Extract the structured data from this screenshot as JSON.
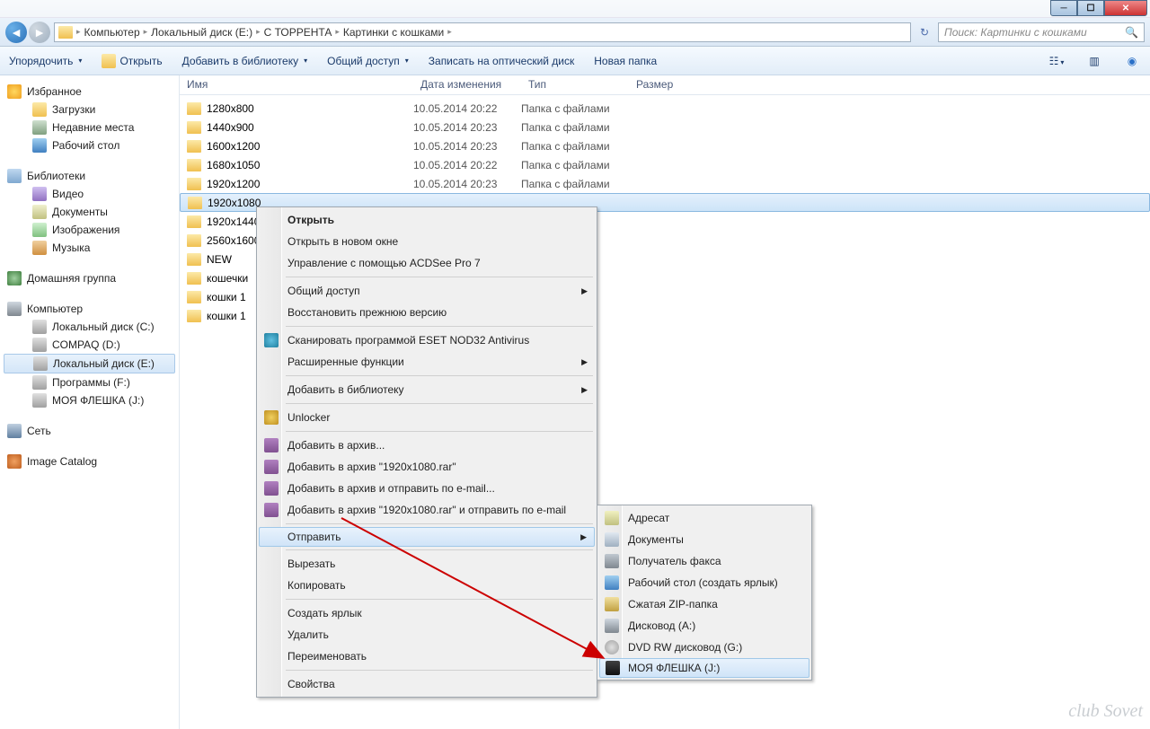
{
  "breadcrumb": [
    "Компьютер",
    "Локальный диск (E:)",
    "С ТОРРЕНТА",
    "Картинки с кошками"
  ],
  "search_placeholder": "Поиск: Картинки с кошками",
  "toolbar": {
    "organize": "Упорядочить",
    "open": "Открыть",
    "add_library": "Добавить в библиотеку",
    "share": "Общий доступ",
    "burn": "Записать на оптический диск",
    "new_folder": "Новая папка"
  },
  "columns": {
    "name": "Имя",
    "date": "Дата изменения",
    "type": "Тип",
    "size": "Размер"
  },
  "sidebar": {
    "favorites": {
      "title": "Избранное",
      "items": [
        "Загрузки",
        "Недавние места",
        "Рабочий стол"
      ]
    },
    "libraries": {
      "title": "Библиотеки",
      "items": [
        "Видео",
        "Документы",
        "Изображения",
        "Музыка"
      ]
    },
    "homegroup": "Домашняя группа",
    "computer": {
      "title": "Компьютер",
      "items": [
        "Локальный диск (C:)",
        "COMPAQ (D:)",
        "Локальный диск (E:)",
        "Программы  (F:)",
        "МОЯ ФЛЕШКА (J:)"
      ]
    },
    "network": "Сеть",
    "catalog": "Image Catalog"
  },
  "files": [
    {
      "name": "1280x800",
      "date": "10.05.2014 20:22",
      "type": "Папка с файлами"
    },
    {
      "name": "1440x900",
      "date": "10.05.2014 20:23",
      "type": "Папка с файлами"
    },
    {
      "name": "1600x1200",
      "date": "10.05.2014 20:23",
      "type": "Папка с файлами"
    },
    {
      "name": "1680x1050",
      "date": "10.05.2014 20:22",
      "type": "Папка с файлами"
    },
    {
      "name": "1920x1200",
      "date": "10.05.2014 20:23",
      "type": "Папка с файлами"
    },
    {
      "name": "1920x1080",
      "date": "",
      "type": "",
      "selected": true
    },
    {
      "name": "1920x1440",
      "date": "",
      "type": ""
    },
    {
      "name": "2560x1600",
      "date": "",
      "type": ""
    },
    {
      "name": "NEW",
      "date": "",
      "type": ""
    },
    {
      "name": "кошечки",
      "date": "",
      "type": ""
    },
    {
      "name": "кошки 1",
      "date": "",
      "type": ""
    },
    {
      "name": "кошки 1",
      "date": "",
      "type": ""
    }
  ],
  "file_tail": "ами",
  "context_menu": [
    {
      "label": "Открыть",
      "bold": true
    },
    {
      "label": "Открыть в новом окне"
    },
    {
      "label": "Управление с помощью ACDSee Pro 7"
    },
    {
      "sep": true
    },
    {
      "label": "Общий доступ",
      "arrow": true
    },
    {
      "label": "Восстановить прежнюю версию"
    },
    {
      "sep": true
    },
    {
      "label": "Сканировать программой ESET NOD32 Antivirus",
      "icon": "ci-nod"
    },
    {
      "label": "Расширенные функции",
      "arrow": true
    },
    {
      "sep": true
    },
    {
      "label": "Добавить в библиотеку",
      "arrow": true
    },
    {
      "sep": true
    },
    {
      "label": "Unlocker",
      "icon": "ci-unl"
    },
    {
      "sep": true
    },
    {
      "label": "Добавить в архив...",
      "icon": "ci-rar"
    },
    {
      "label": "Добавить в архив \"1920x1080.rar\"",
      "icon": "ci-rar"
    },
    {
      "label": "Добавить в архив и отправить по e-mail...",
      "icon": "ci-rar"
    },
    {
      "label": "Добавить в архив \"1920x1080.rar\" и отправить по e-mail",
      "icon": "ci-rar"
    },
    {
      "sep": true
    },
    {
      "label": "Отправить",
      "arrow": true,
      "highlighted": true
    },
    {
      "sep": true
    },
    {
      "label": "Вырезать"
    },
    {
      "label": "Копировать"
    },
    {
      "sep": true
    },
    {
      "label": "Создать ярлык"
    },
    {
      "label": "Удалить"
    },
    {
      "label": "Переименовать"
    },
    {
      "sep": true
    },
    {
      "label": "Свойства"
    }
  ],
  "send_to_menu": [
    {
      "label": "Адресат",
      "icon": "ci-mail"
    },
    {
      "label": "Документы",
      "icon": "ci-doc2"
    },
    {
      "label": "Получатель факса",
      "icon": "ci-fax"
    },
    {
      "label": "Рабочий стол (создать ярлык)",
      "icon": "ci-desk2"
    },
    {
      "label": "Сжатая ZIP-папка",
      "icon": "ci-zip"
    },
    {
      "label": "Дисковод (A:)",
      "icon": "ci-floppy"
    },
    {
      "label": "DVD RW дисковод (G:)",
      "icon": "ci-dvd"
    },
    {
      "label": "МОЯ ФЛЕШКА (J:)",
      "icon": "ci-usb",
      "highlighted": true
    }
  ],
  "watermark": "club\nSovet"
}
